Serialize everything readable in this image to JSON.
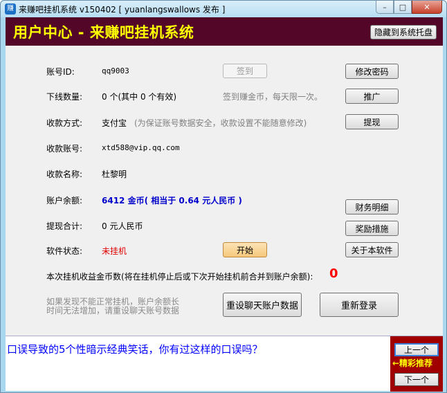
{
  "window": {
    "title": "来赚吧挂机系统 v150402 [ yuanlangswallows 发布 ]",
    "controls": {
      "minimize": "–",
      "maximize": "□",
      "close": "✕"
    }
  },
  "header": {
    "title": "用户中心 - 来赚吧挂机系统",
    "hide_tray_button": "隐藏到系统托盘"
  },
  "account": {
    "id_label": "账号ID:",
    "id_value": "qq9003",
    "signin_button": "签到",
    "change_pwd_button": "修改密码",
    "downline_label": "下线数量:",
    "downline_value": "0 个(其中 0 个有效)",
    "signin_hint": "签到赚金币，每天限一次。",
    "promote_button": "推广",
    "pay_method_label": "收款方式:",
    "pay_method_value": "支付宝",
    "pay_method_note": "(为保证账号数据安全，收款设置不能随意修改)",
    "withdraw_button": "提现",
    "pay_account_label": "收款账号:",
    "pay_account_value": "xtd588@vip.qq.com",
    "pay_name_label": "收款名称:",
    "pay_name_value": "杜黎明",
    "balance_label": "账户余额:",
    "balance_value": "6412 金币( 相当于 0.64 元人民币 )",
    "finance_button": "财务明细",
    "withdraw_total_label": "提现合计:",
    "withdraw_total_value": "0 元人民币",
    "reward_button": "奖励措施",
    "status_label": "软件状态:",
    "status_value": "未挂机",
    "start_button": "开始",
    "about_button": "关于本软件",
    "earn_label": "本次挂机收益金币数(将在挂机停止后或下次开始挂机前合并到账户余额):",
    "earn_value": "0",
    "note_line1": "如果发现不能正常挂机，账户余额长",
    "note_line2": "时间无法增加，请重设聊天账号数据",
    "reset_chat_button": "重设聊天账户数据",
    "relogin_button": "重新登录"
  },
  "news": {
    "headline": "口误导致的5个性暗示经典笑话，你有过这样的口误吗？",
    "prev_button": "上一个",
    "featured_label": "←精彩推荐",
    "next_button": "下一个"
  },
  "colors": {
    "header_bg": "#540629",
    "header_title": "#ffff00",
    "link": "#0000ff",
    "status_red": "#e00000",
    "side_bg": "#a00000"
  }
}
